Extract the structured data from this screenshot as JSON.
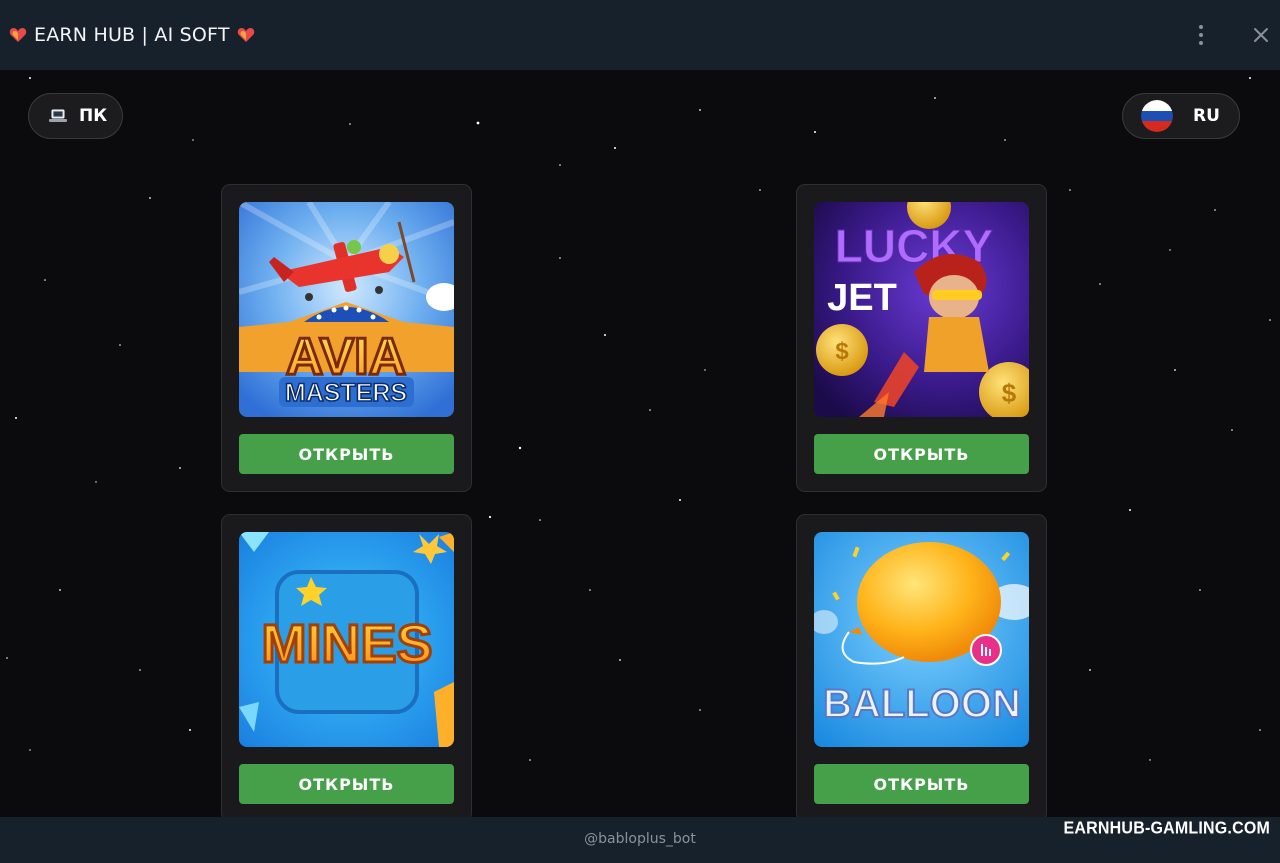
{
  "window": {
    "title": "EARN HUB | AI SOFT",
    "title_icon": "heart-icon",
    "menu_icon": "kebab-menu-icon",
    "close_icon": "close-icon"
  },
  "controls": {
    "device": {
      "icon": "laptop-icon",
      "label": "ПК"
    },
    "language": {
      "icon": "russia-flag-icon",
      "label": "RU"
    }
  },
  "games": [
    {
      "name": "Avia Masters",
      "image": "AVIA MASTERS",
      "image_line1": "AVIA",
      "image_line2": "MASTERS",
      "button": "ОТКРЫТЬ"
    },
    {
      "name": "Lucky Jet",
      "image": "LUCKY JET",
      "image_line1": "LUCKY",
      "image_line2": "JET",
      "button": "ОТКРЫТЬ"
    },
    {
      "name": "Mines",
      "image": "MINES",
      "image_line1": "MINES",
      "button": "ОТКРЫТЬ"
    },
    {
      "name": "Balloon",
      "image": "BALLOON",
      "image_line1": "BALLOON",
      "button": "ОТКРЫТЬ"
    }
  ],
  "footer": {
    "handle": "@babloplus_bot",
    "watermark": "EARNHUB-GAMLING.COM"
  },
  "colors": {
    "titlebar": "#17212b",
    "background": "#0b0b0d",
    "card": "#1a1a1c",
    "button": "#45a049"
  }
}
